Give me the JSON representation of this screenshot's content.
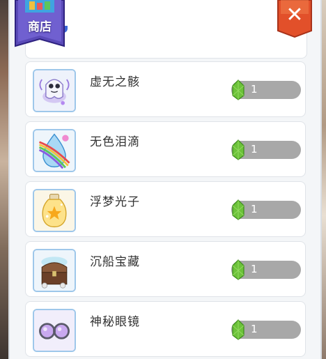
{
  "shop": {
    "tab_label": "商店",
    "close_label": "✕"
  },
  "items": [
    {
      "name": "虚无之骸",
      "price": "1",
      "icon": "ghost-icon"
    },
    {
      "name": "无色泪滴",
      "price": "1",
      "icon": "rainbow-teardrop-icon"
    },
    {
      "name": "浮梦光子",
      "price": "1",
      "icon": "star-jar-icon"
    },
    {
      "name": "沉船宝藏",
      "price": "1",
      "icon": "treasure-chest-icon"
    },
    {
      "name": "神秘眼镜",
      "price": "1",
      "icon": "goggles-icon"
    }
  ],
  "currency": {
    "icon": "green-crystal-icon"
  }
}
